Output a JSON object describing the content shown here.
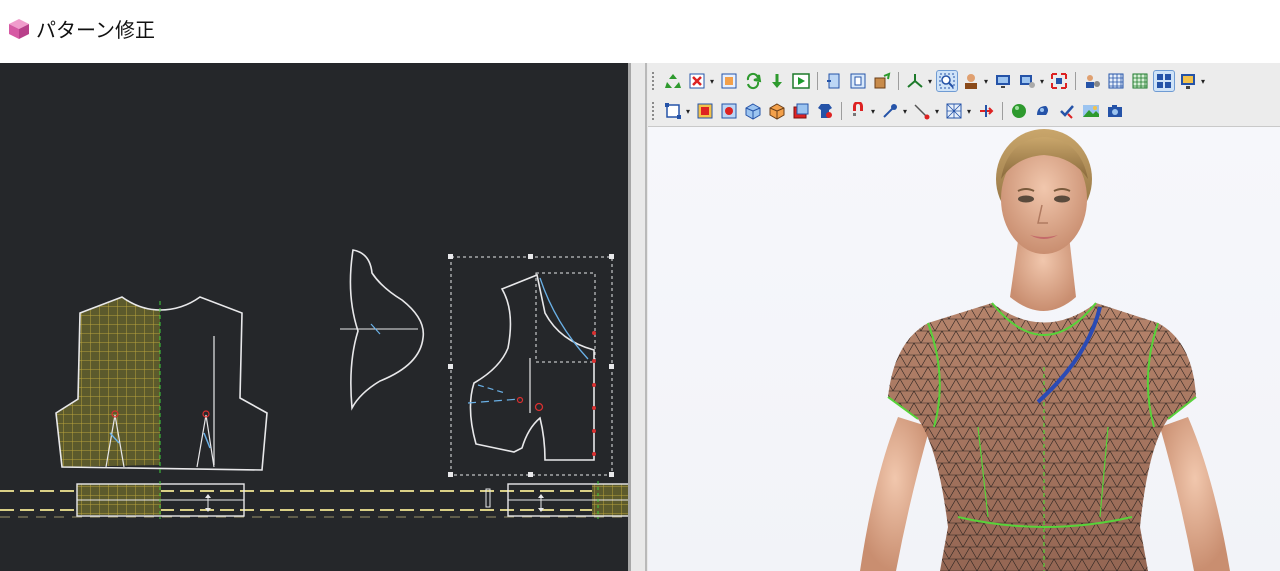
{
  "window": {
    "title": "パターン修正",
    "icon": "pattern-cube-icon"
  },
  "colors": {
    "canvas_bg": "#25272a",
    "pattern_line": "#e8e8ea",
    "grid_yellow": "#b8a33c",
    "seam_green": "#3fcf3a",
    "seam_blue": "#2a4bb5",
    "accent_red": "#d93030",
    "toolbar_bg": "#ececec"
  },
  "toolbar": {
    "row1": [
      {
        "name": "recycle-icon",
        "dropdown": false
      },
      {
        "name": "delete-pattern-icon",
        "dropdown": true
      },
      {
        "name": "pattern-select-icon",
        "dropdown": false
      },
      {
        "name": "refresh-icon",
        "dropdown": false
      },
      {
        "name": "arrow-down-icon",
        "dropdown": false
      },
      {
        "name": "play-simulation-icon",
        "dropdown": false
      },
      {
        "name": "sep",
        "dropdown": false
      },
      {
        "name": "rotate-view-icon",
        "dropdown": false
      },
      {
        "name": "fit-view-icon",
        "dropdown": false
      },
      {
        "name": "texture-icon",
        "dropdown": false
      },
      {
        "name": "sep",
        "dropdown": false
      },
      {
        "name": "axis-icon",
        "dropdown": true
      },
      {
        "name": "zoom-window-icon",
        "dropdown": false,
        "pressed": true
      },
      {
        "name": "avatar-icon",
        "dropdown": true
      },
      {
        "name": "monitor-icon",
        "dropdown": false
      },
      {
        "name": "render-settings-icon",
        "dropdown": true
      },
      {
        "name": "fullscreen-icon",
        "dropdown": false
      },
      {
        "name": "sep",
        "dropdown": false
      },
      {
        "name": "user-settings-icon",
        "dropdown": false
      },
      {
        "name": "grid-table-icon",
        "dropdown": false
      },
      {
        "name": "grid-green-icon",
        "dropdown": false
      },
      {
        "name": "layout-icon",
        "dropdown": false,
        "pressed": true
      },
      {
        "name": "display-icon",
        "dropdown": true
      }
    ],
    "row2": [
      {
        "name": "select-box-icon",
        "dropdown": true
      },
      {
        "name": "pattern-front-icon",
        "dropdown": false
      },
      {
        "name": "pattern-back-icon",
        "dropdown": false
      },
      {
        "name": "cube-view-icon",
        "dropdown": false
      },
      {
        "name": "cube-side-icon",
        "dropdown": false
      },
      {
        "name": "fabric-icon",
        "dropdown": false
      },
      {
        "name": "shirt-icon",
        "dropdown": false
      },
      {
        "name": "sep",
        "dropdown": false
      },
      {
        "name": "magnet-icon",
        "dropdown": true
      },
      {
        "name": "pin-icon",
        "dropdown": true
      },
      {
        "name": "needle-icon",
        "dropdown": true
      },
      {
        "name": "mesh-icon",
        "dropdown": true
      },
      {
        "name": "arrow-rotate-icon",
        "dropdown": false
      },
      {
        "name": "sep",
        "dropdown": false
      },
      {
        "name": "sphere-icon",
        "dropdown": false
      },
      {
        "name": "mouse-icon",
        "dropdown": false
      },
      {
        "name": "check-icon",
        "dropdown": false
      },
      {
        "name": "landscape-icon",
        "dropdown": false
      },
      {
        "name": "camera-icon",
        "dropdown": false
      }
    ]
  }
}
